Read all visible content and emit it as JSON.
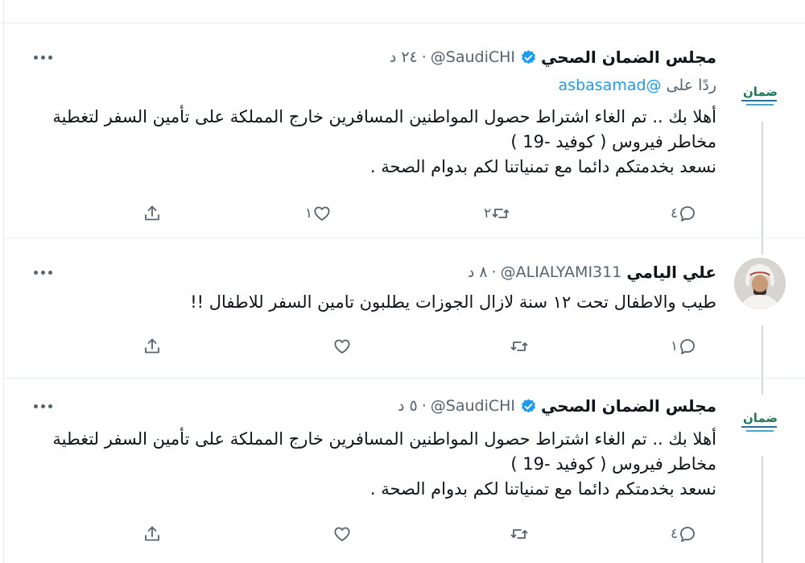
{
  "tweets": [
    {
      "name": "مجلس الضمان الصحي",
      "handle": "@SaudiCHI",
      "dot": "·",
      "time": "٢٤ د",
      "avatar": "chi-logo",
      "verified": true,
      "replying_prefix": "ردًا على",
      "replying_to": "@asbasamad",
      "text": "أهلا بك .. تم الغاء اشتراط حصول المواطنين المسافرين خارج المملكة على تأمين السفر لتغطية مخاطر فيروس ( كوفيد -19 )\nنسعد بخدمتكم دائما مع تمنياتنا لكم بدوام الصحة .",
      "reply_count": "٤",
      "retweet_count": "٢",
      "like_count": "١",
      "share_count": ""
    },
    {
      "name": "علي اليامي",
      "handle": "@ALIALYAMI311",
      "dot": "·",
      "time": "٨ د",
      "avatar": "user-photo",
      "verified": false,
      "text": "طيب والاطفال تحت ١٢ سنة لازال الجوزات يطلبون تامين السفر للاطفال !!",
      "reply_count": "١",
      "retweet_count": "",
      "like_count": "",
      "share_count": ""
    },
    {
      "name": "مجلس الضمان الصحي",
      "handle": "@SaudiCHI",
      "dot": "·",
      "time": "٥ د",
      "avatar": "chi-logo",
      "verified": true,
      "text": "أهلا بك .. تم الغاء اشتراط حصول المواطنين المسافرين خارج المملكة على تأمين السفر لتغطية مخاطر فيروس ( كوفيد -19 )\nنسعد بخدمتكم دائما مع تمنياتنا لكم بدوام الصحة .",
      "reply_count": "٤",
      "retweet_count": "",
      "like_count": "",
      "share_count": ""
    }
  ],
  "logo": {
    "text": "ضمان"
  },
  "icons": {
    "reply": "reply-icon",
    "retweet": "retweet-icon",
    "like": "heart-icon",
    "share": "share-icon",
    "more": "more-icon",
    "verified": "verified-badge-icon"
  },
  "colors": {
    "accent": "#1d9bf0",
    "secondary_text": "#536471",
    "border": "#e6ecf0"
  }
}
